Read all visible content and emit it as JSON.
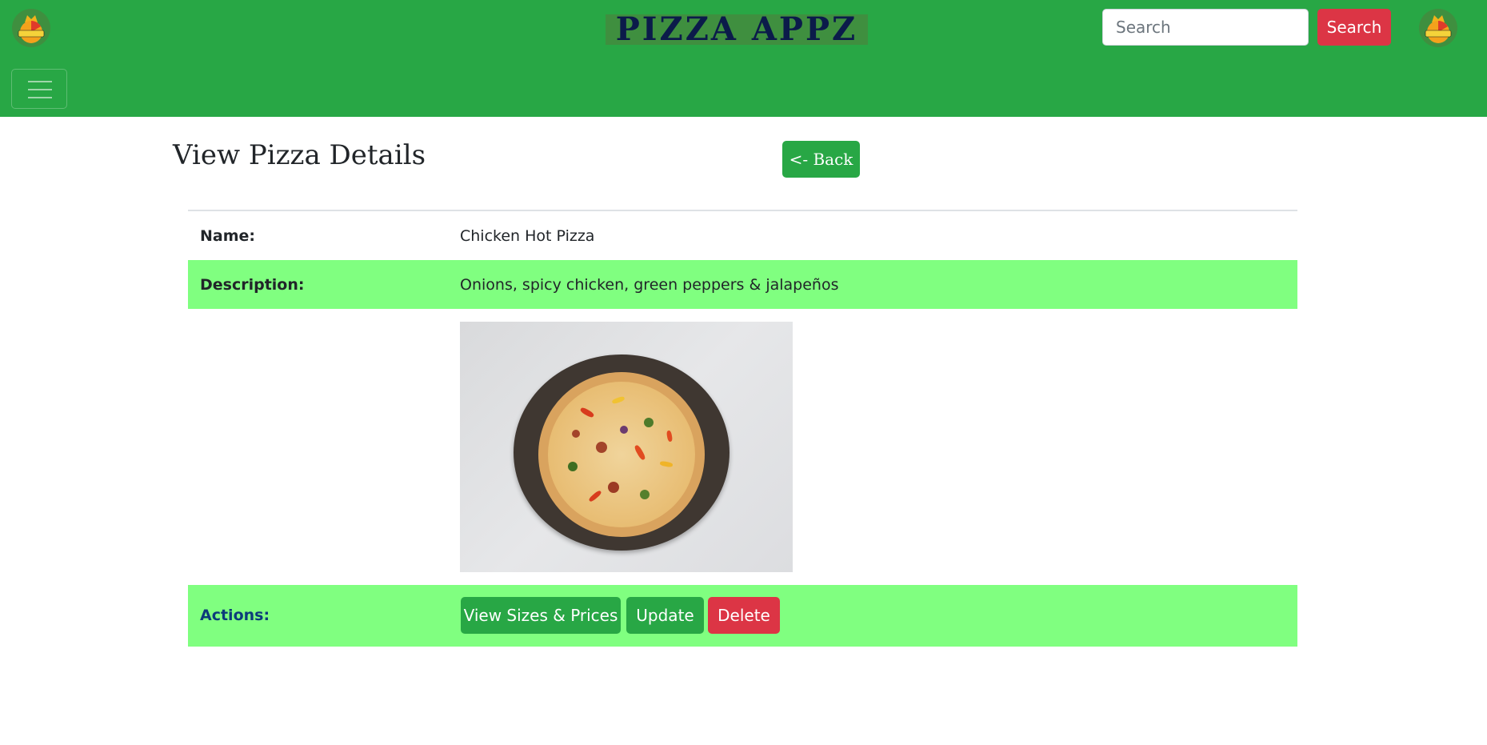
{
  "navbar": {
    "brand": "PIZZA APPZ",
    "logo_text": "PIZZA APPZ",
    "search_placeholder": "Search",
    "search_button": "Search",
    "bg_color": "#28a745"
  },
  "page": {
    "title": "View Pizza Details",
    "back_button": "<- Back"
  },
  "details": {
    "name_label": "Name:",
    "name_value": "Chicken Hot Pizza",
    "description_label": "Description:",
    "description_value": "Onions, spicy chicken, green peppers & jalapeños",
    "row_highlight_color": "#80ff80"
  },
  "actions": {
    "label": "Actions:",
    "view_sizes": "View Sizes & Prices",
    "update": "Update",
    "delete": "Delete"
  },
  "colors": {
    "primary": "#28a745",
    "danger": "#dc3545"
  }
}
